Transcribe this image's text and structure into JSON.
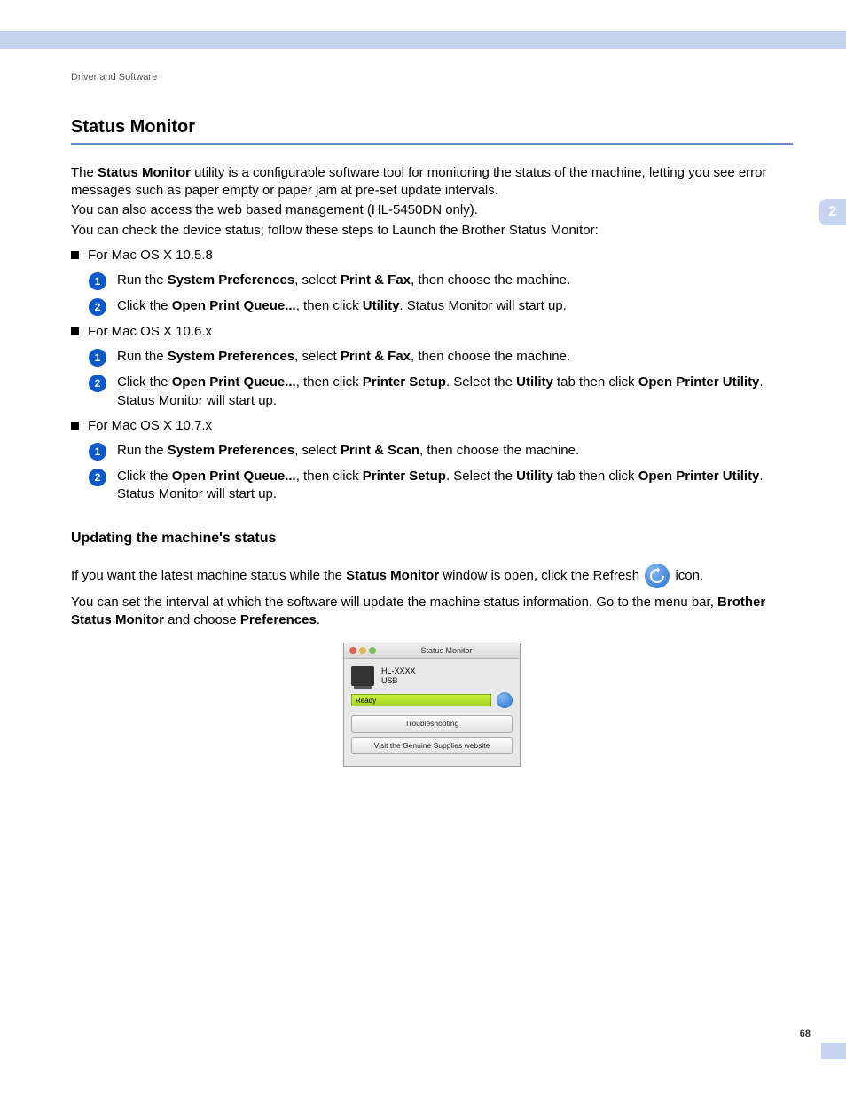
{
  "breadcrumb": "Driver and Software",
  "title": "Status Monitor",
  "chapter_tab": "2",
  "intro": {
    "p1a": "The ",
    "p1b": "Status Monitor",
    "p1c": " utility is a configurable software tool for monitoring the status of the machine, letting you see error messages such as paper empty or paper jam at pre-set update intervals.",
    "p2": "You can also access the web based management (HL-5450DN only).",
    "p3": "You can check the device status; follow these steps to Launch the Brother Status Monitor:"
  },
  "sec1058": {
    "label": "For Mac OS X 10.5.8",
    "s1": {
      "a": "Run the ",
      "b": "System Preferences",
      "c": ", select ",
      "d": "Print & Fax",
      "e": ", then choose the machine."
    },
    "s2": {
      "a": "Click the ",
      "b": "Open Print Queue...",
      "c": ", then click ",
      "d": "Utility",
      "e": ". Status Monitor will start up."
    }
  },
  "sec106": {
    "label": "For Mac OS X 10.6.x",
    "s1": {
      "a": "Run the ",
      "b": "System Preferences",
      "c": ", select ",
      "d": "Print & Fax",
      "e": ", then choose the machine."
    },
    "s2": {
      "a": "Click the ",
      "b": "Open Print Queue...",
      "c": ", then click ",
      "d": "Printer Setup",
      "e": ". Select the ",
      "f": "Utility",
      "g": " tab then click ",
      "h": "Open Printer Utility",
      "i": ". Status Monitor will start up."
    }
  },
  "sec107": {
    "label": "For Mac OS X 10.7.x",
    "s1": {
      "a": "Run the ",
      "b": "System Preferences",
      "c": ", select ",
      "d": "Print & Scan",
      "e": ", then choose the machine."
    },
    "s2": {
      "a": "Click the ",
      "b": "Open Print Queue...",
      "c": ", then click ",
      "d": "Printer Setup",
      "e": ". Select the ",
      "f": "Utility",
      "g": " tab then click ",
      "h": "Open Printer Utility",
      "i": ". Status Monitor will start up."
    }
  },
  "update": {
    "heading": "Updating the machine's status",
    "p1a": "If you want the latest machine status while the ",
    "p1b": "Status Monitor",
    "p1c": " window is open, click the Refresh ",
    "p1d": " icon.",
    "p2a": "You can set the interval at which the software will update the machine status information. Go to the menu bar, ",
    "p2b": "Brother Status Monitor",
    "p2c": " and choose ",
    "p2d": "Preferences",
    "p2e": "."
  },
  "dialog": {
    "title": "Status Monitor",
    "model": "HL-XXXX",
    "conn": "USB",
    "status": "Ready",
    "btn1": "Troubleshooting",
    "btn2": "Visit the Genuine Supplies website"
  },
  "page_number": "68"
}
